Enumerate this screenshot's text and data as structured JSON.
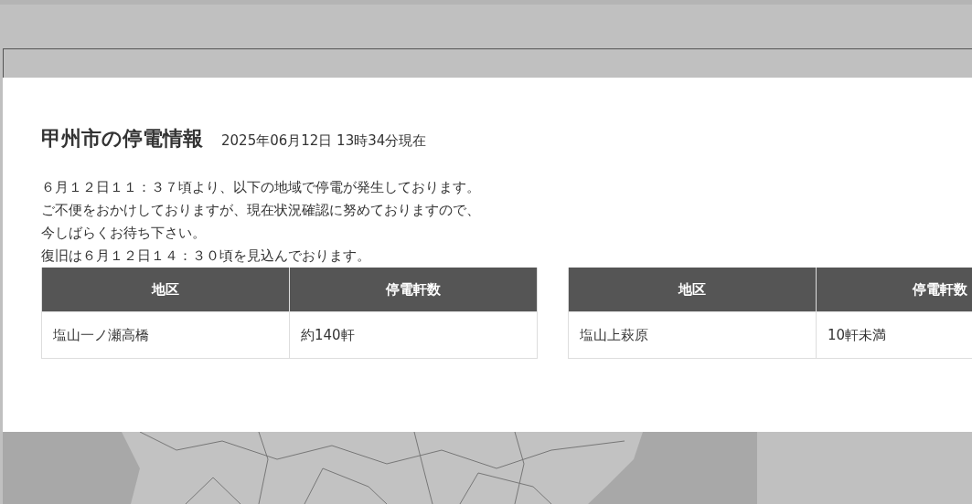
{
  "modal": {
    "title": "甲州市の停電情報",
    "timestamp": "2025年06月12日 13時34分現在",
    "notice_lines": [
      "６月１２日１１：３７頃より、以下の地域で停電が発生しております。",
      "ご不便をおかけしておりますが、現在状況確認に努めておりますので、",
      "今しばらくお待ち下さい。",
      "復旧は６月１２日１４：３０頃を見込んでおります。"
    ],
    "tables": [
      {
        "columns": [
          "地区",
          "停電軒数"
        ],
        "rows": [
          [
            "塩山一ノ瀬高橋",
            "約140軒"
          ]
        ]
      },
      {
        "columns": [
          "地区",
          "停電軒数"
        ],
        "rows": [
          [
            "塩山上萩原",
            "10軒未満"
          ]
        ]
      }
    ]
  }
}
